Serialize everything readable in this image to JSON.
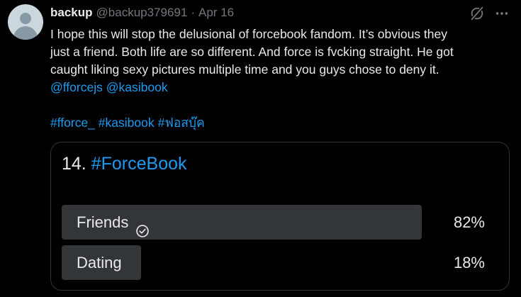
{
  "author": {
    "name": "backup",
    "handle": "@backup379691",
    "separator": "·",
    "date": "Apr 16"
  },
  "tweet": {
    "lines": [
      "I hope this will stop the delusional of forcebook fandom. It’s obvious they",
      "just a friend. Both life are so different. And force is fvcking straight. He got",
      "caught liking sexy pictures multiple time and you guys chose to deny it."
    ],
    "mentions": [
      "@fforcejs",
      "@kasibook"
    ],
    "hashtags": [
      "#fforce_",
      "#kasibook",
      "#ฟอสบุ๊ค"
    ]
  },
  "poll": {
    "number": "14.",
    "title_hashtag": "#ForceBook",
    "options": [
      {
        "label": "Friends",
        "percent": "82%",
        "value": 0.82,
        "winner": true
      },
      {
        "label": "Dating",
        "percent": "18%",
        "value": 0.18,
        "winner": false
      }
    ]
  },
  "icons": {
    "avatar": "default-avatar",
    "grok": "grok-icon",
    "more": "more-icon",
    "check": "check-circle-icon"
  },
  "colors": {
    "background": "#000000",
    "link": "#1d9bf0",
    "muted": "#71767b",
    "bar": "#333639"
  }
}
